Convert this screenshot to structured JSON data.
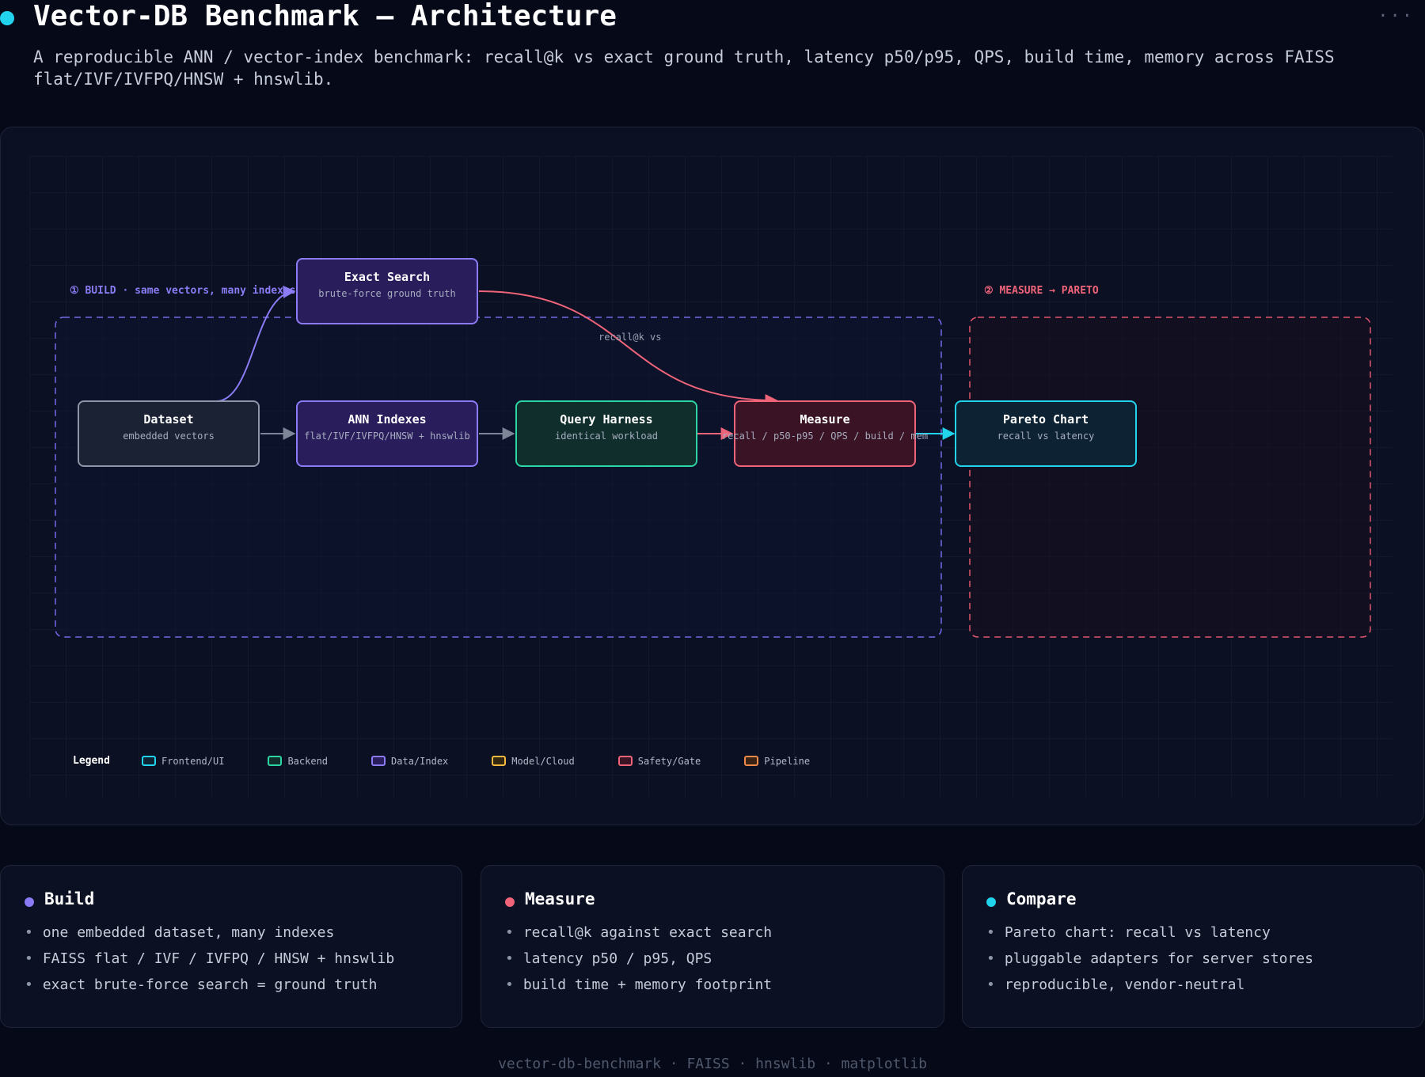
{
  "header": {
    "title": "Vector-DB Benchmark — Architecture",
    "subtitle": "A reproducible ANN / vector-index benchmark: recall@k vs exact ground truth, latency p50/p95, QPS, build time, memory across FAISS flat/IVF/IVFPQ/HNSW + hnswlib.",
    "more_label": "···"
  },
  "diagram": {
    "groups": [
      {
        "label": "① BUILD · same vectors, many indexes",
        "color": "#8b7cf6"
      },
      {
        "label": "② MEASURE → PARETO",
        "color": "#f0647a"
      }
    ],
    "nodes": [
      {
        "id": "exact",
        "title": "Exact Search",
        "sub": "brute-force ground truth",
        "category": "Data/Index"
      },
      {
        "id": "dataset",
        "title": "Dataset",
        "sub": "embedded vectors",
        "category": "neutral"
      },
      {
        "id": "ann",
        "title": "ANN Indexes",
        "sub": "flat/IVF/IVFPQ/HNSW + hnswlib",
        "category": "Data/Index"
      },
      {
        "id": "query",
        "title": "Query Harness",
        "sub": "identical workload",
        "category": "Backend"
      },
      {
        "id": "measure",
        "title": "Measure",
        "sub": "recall / p50-p95 / QPS / build / mem",
        "category": "Safety/Gate"
      },
      {
        "id": "pareto",
        "title": "Pareto Chart",
        "sub": "recall vs latency",
        "category": "Frontend/UI"
      }
    ],
    "edges": [
      {
        "from": "dataset",
        "to": "exact",
        "label": ""
      },
      {
        "from": "dataset",
        "to": "ann",
        "label": ""
      },
      {
        "from": "ann",
        "to": "query",
        "label": ""
      },
      {
        "from": "query",
        "to": "measure",
        "label": ""
      },
      {
        "from": "exact",
        "to": "measure",
        "label": "recall@k vs"
      },
      {
        "from": "measure",
        "to": "pareto",
        "label": ""
      }
    ],
    "legend": {
      "title": "Legend",
      "items": [
        {
          "label": "Frontend/UI",
          "color": "#22d3ee"
        },
        {
          "label": "Backend",
          "color": "#2dd4a4"
        },
        {
          "label": "Data/Index",
          "color": "#8b7cf6"
        },
        {
          "label": "Model/Cloud",
          "color": "#f5b942"
        },
        {
          "label": "Safety/Gate",
          "color": "#f0647a"
        },
        {
          "label": "Pipeline",
          "color": "#f08a4b"
        }
      ]
    }
  },
  "cards": [
    {
      "title": "Build",
      "color": "#8b7cf6",
      "items": [
        "one embedded dataset, many indexes",
        "FAISS flat / IVF / IVFPQ / HNSW + hnswlib",
        "exact brute-force search = ground truth"
      ]
    },
    {
      "title": "Measure",
      "color": "#f0647a",
      "items": [
        "recall@k against exact search",
        "latency p50 / p95, QPS",
        "build time + memory footprint"
      ]
    },
    {
      "title": "Compare",
      "color": "#22d3ee",
      "items": [
        "Pareto chart: recall vs latency",
        "pluggable adapters for server stores",
        "reproducible, vendor-neutral"
      ]
    }
  ],
  "footer": "vector-db-benchmark · FAISS · hnswlib · matplotlib"
}
